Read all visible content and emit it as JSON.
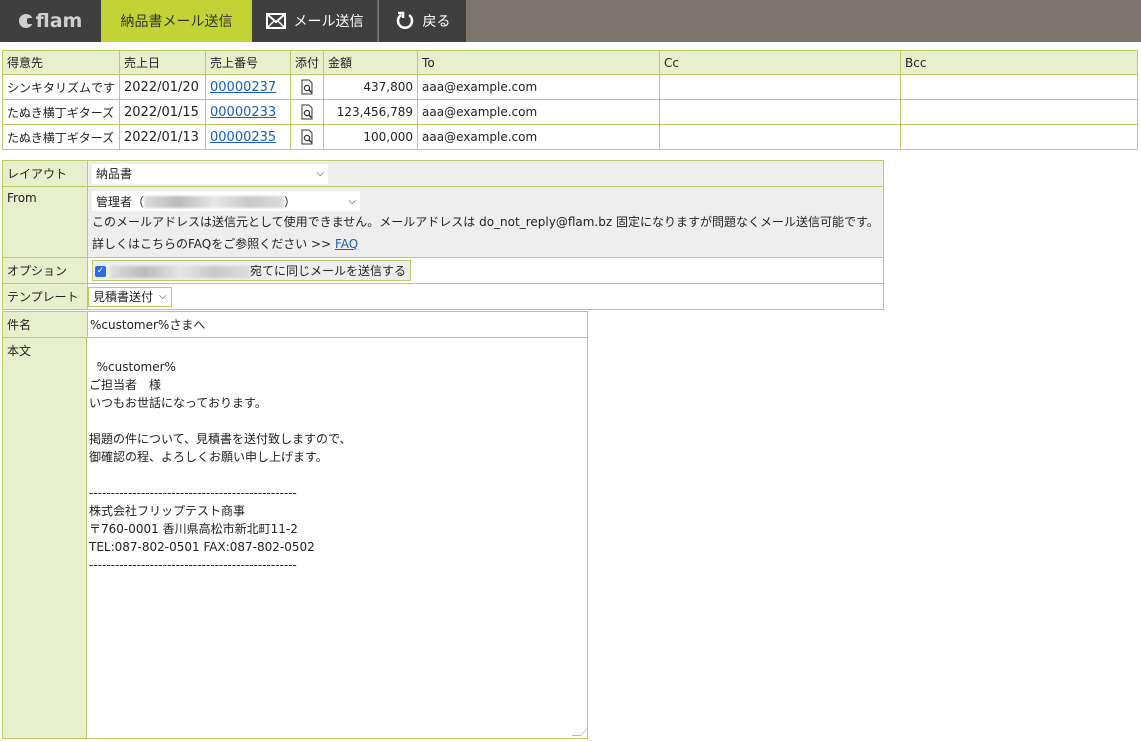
{
  "app": {
    "logo_text": "flam"
  },
  "tabs": {
    "active": "納品書メール送信",
    "send": "メール送信",
    "back": "戻る"
  },
  "list": {
    "headers": [
      "得意先",
      "売上日",
      "売上番号",
      "添付",
      "金額",
      "To",
      "Cc",
      "Bcc"
    ],
    "rows": [
      {
        "customer": "シンキタリズムです",
        "date": "2022/01/20",
        "number": "00000237",
        "amount": "437,800",
        "to": "aaa@example.com",
        "cc": "",
        "bcc": ""
      },
      {
        "customer": "たぬき横丁ギターズ",
        "date": "2022/01/15",
        "number": "00000233",
        "amount": "123,456,789",
        "to": "aaa@example.com",
        "cc": "",
        "bcc": ""
      },
      {
        "customer": "たぬき横丁ギターズ",
        "date": "2022/01/13",
        "number": "00000235",
        "amount": "100,000",
        "to": "aaa@example.com",
        "cc": "",
        "bcc": ""
      }
    ]
  },
  "form": {
    "layout_label": "レイアウト",
    "layout_value": "納品書",
    "from_label": "From",
    "from_prefix": "管理者（",
    "from_suffix": "）",
    "from_note": "このメールアドレスは送信元として使用できません。メールアドレスは do_not_reply@flam.bz 固定になりますが問題なくメール送信可能です。",
    "faq_text": "詳しくはこちらのFAQをご参照ください >> ",
    "faq_link": "FAQ",
    "option_label": "オプション",
    "option_text": "宛てに同じメールを送信する",
    "template_label": "テンプレート",
    "template_value": "見積書送付",
    "subject_label": "件名",
    "subject_value": "%customer%さまへ",
    "body_label": "本文",
    "body_value": "%customer%\nご担当者　様\nいつもお世話になっております。\n\n掲題の件について、見積書を送付致しますので、\n御確認の程、よろしくお願い申し上げます。\n\n------------------------------------------------\n株式会社フリップテスト商事\n〒760-0001 香川県高松市新北町11-2\nTEL:087-802-0501 FAX:087-802-0502\n------------------------------------------------"
  }
}
